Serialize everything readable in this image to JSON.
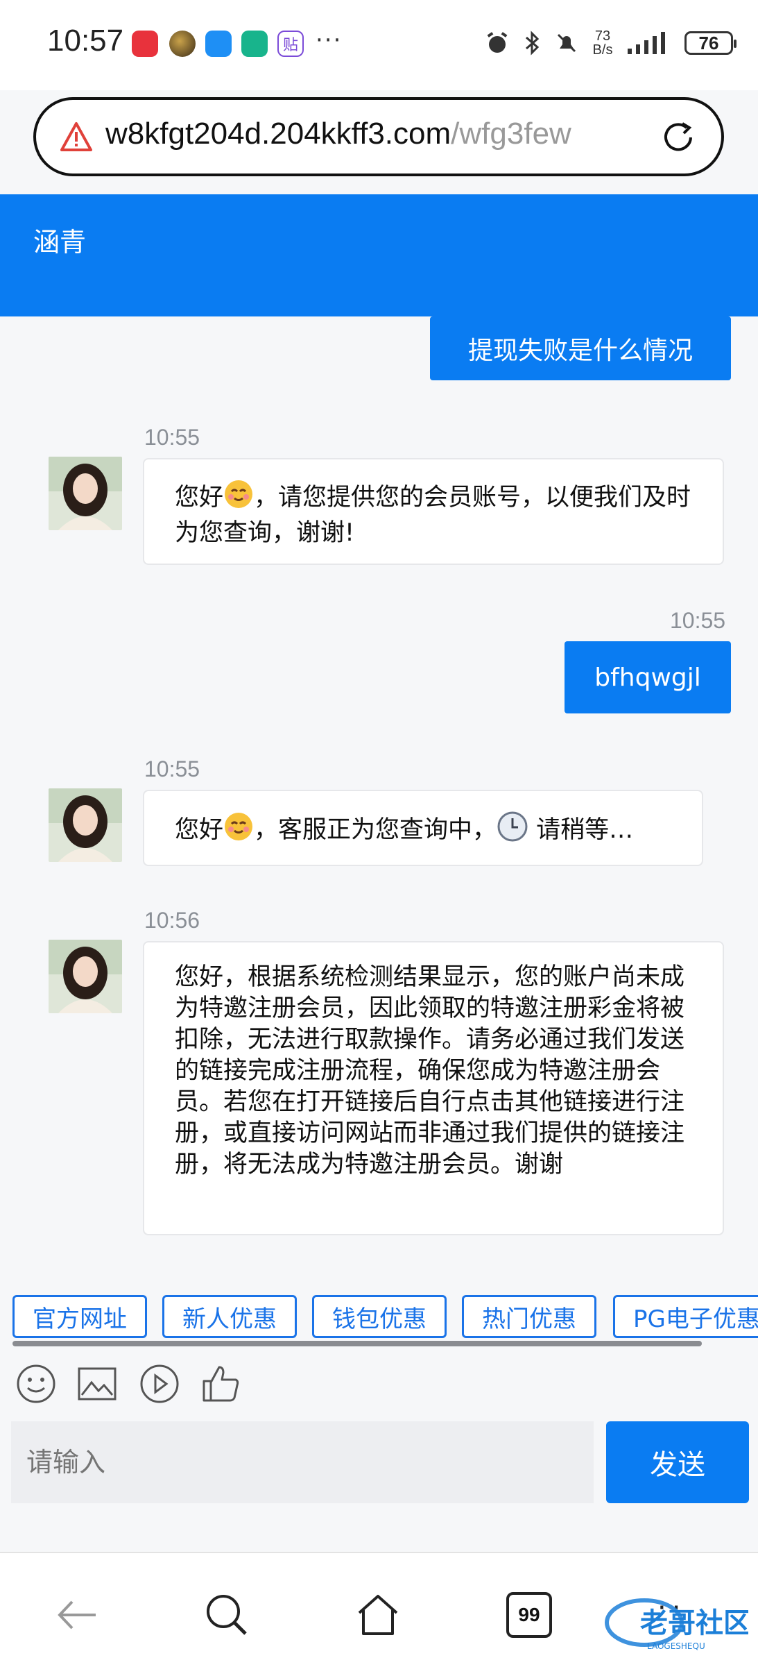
{
  "status_bar": {
    "time": "10:57",
    "more": "···",
    "net_speed_value": "73",
    "net_speed_unit": "B/s",
    "battery": "76"
  },
  "url_bar": {
    "domain": "w8kfgt204d.204kkff3.com",
    "path": "/wfg3few"
  },
  "chat": {
    "agent_name": "涵青",
    "messages": [
      {
        "side": "right",
        "text": "提现失败是什么情况"
      },
      {
        "side": "left",
        "time": "10:55",
        "text_a": "您好",
        "text_b": "，请您提供您的会员账号，以便我们及时为您查询，谢谢!"
      },
      {
        "side": "right",
        "time": "10:55",
        "text": "bfhqwgjl"
      },
      {
        "side": "left",
        "time": "10:55",
        "text_a": "您好",
        "text_b": "，客服正为您查询中，",
        "text_c": "请稍等…"
      },
      {
        "side": "left",
        "time": "10:56",
        "text": "您好，根据系统检测结果显示，您的账户尚未成为特邀注册会员，因此领取的特邀注册彩金将被扣除，无法进行取款操作。请务必通过我们发送的链接完成注册流程，确保您成为特邀注册会员。若您在打开链接后自行点击其他链接进行注册，或直接访问网站而非通过我们提供的链接注册，将无法成为特邀注册会员。谢谢"
      }
    ]
  },
  "quick_buttons": [
    "官方网址",
    "新人优惠",
    "钱包优惠",
    "热门优惠",
    "PG电子优惠"
  ],
  "input": {
    "placeholder": "请输入",
    "send_label": "发送"
  },
  "nav": {
    "tabs_count": "99",
    "watermark_text": "老哥社区",
    "watermark_sub": "LAOGESHEQU"
  },
  "colors": {
    "accent": "#0a7cf2",
    "link": "#1a73e8"
  }
}
